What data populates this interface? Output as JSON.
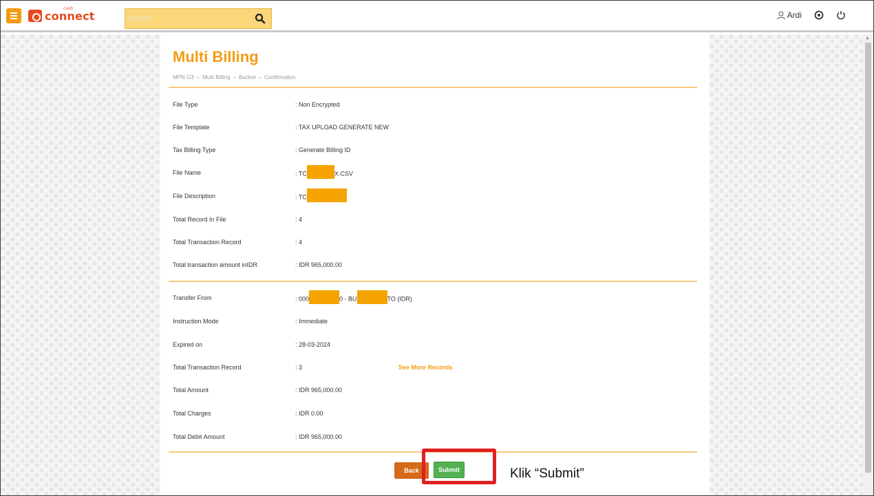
{
  "topbar": {
    "logo_small": "cash",
    "logo_text": "connect",
    "search_placeholder": "search",
    "user_name": "Ardi",
    "icons": [
      "menu-icon",
      "search-icon",
      "user-icon",
      "settings-icon",
      "power-icon"
    ]
  },
  "page": {
    "title": "Multi Billing",
    "breadcrumb": [
      "MPN G3",
      "Multi Billing",
      "Bucket",
      "Confirmation"
    ],
    "breadcrumb_sep": "»"
  },
  "section1": [
    {
      "label": "File Type",
      "value": ": Non Encrypted"
    },
    {
      "label": "File Template",
      "value": ": TAX UPLOAD GENERATE NEW"
    },
    {
      "label": "Tax Billing Type",
      "value": ": Generate Billing ID"
    },
    {
      "label": "File Name",
      "value_prefix": ": TC",
      "value_suffix": "X.CSV"
    },
    {
      "label": "File Description",
      "value_prefix": ": TC"
    },
    {
      "label": "Total Record In File",
      "value": ": 4"
    },
    {
      "label": "Total Transaction Record",
      "value": ": 4"
    },
    {
      "label": "Total transaction amount inIDR",
      "value": ": IDR 965,000.00"
    }
  ],
  "section2": [
    {
      "label": "Transfer From",
      "value_a": ": 000",
      "value_b": "0 - BU",
      "value_c": "TO (IDR)"
    },
    {
      "label": "Instruction Mode",
      "value": ": Immediate"
    },
    {
      "label": "Expired on",
      "value": ": 28-03-2024"
    },
    {
      "label": "Total Transaction Record",
      "value": ": 3",
      "link": "See More Records"
    },
    {
      "label": "Total Amount",
      "value": ": IDR 965,000.00"
    },
    {
      "label": "Total Charges",
      "value": ": IDR 0.00"
    },
    {
      "label": "Total Debit Amount",
      "value": ": IDR 965,000.00"
    }
  ],
  "buttons": {
    "back": "Back",
    "submit": "Submit"
  },
  "annotation": "Klik “Submit”",
  "colors": {
    "accent": "#f39c12",
    "submit": "#54b151",
    "back": "#d46a1a",
    "highlight": "#e02020",
    "redaction": "#f5a300"
  }
}
